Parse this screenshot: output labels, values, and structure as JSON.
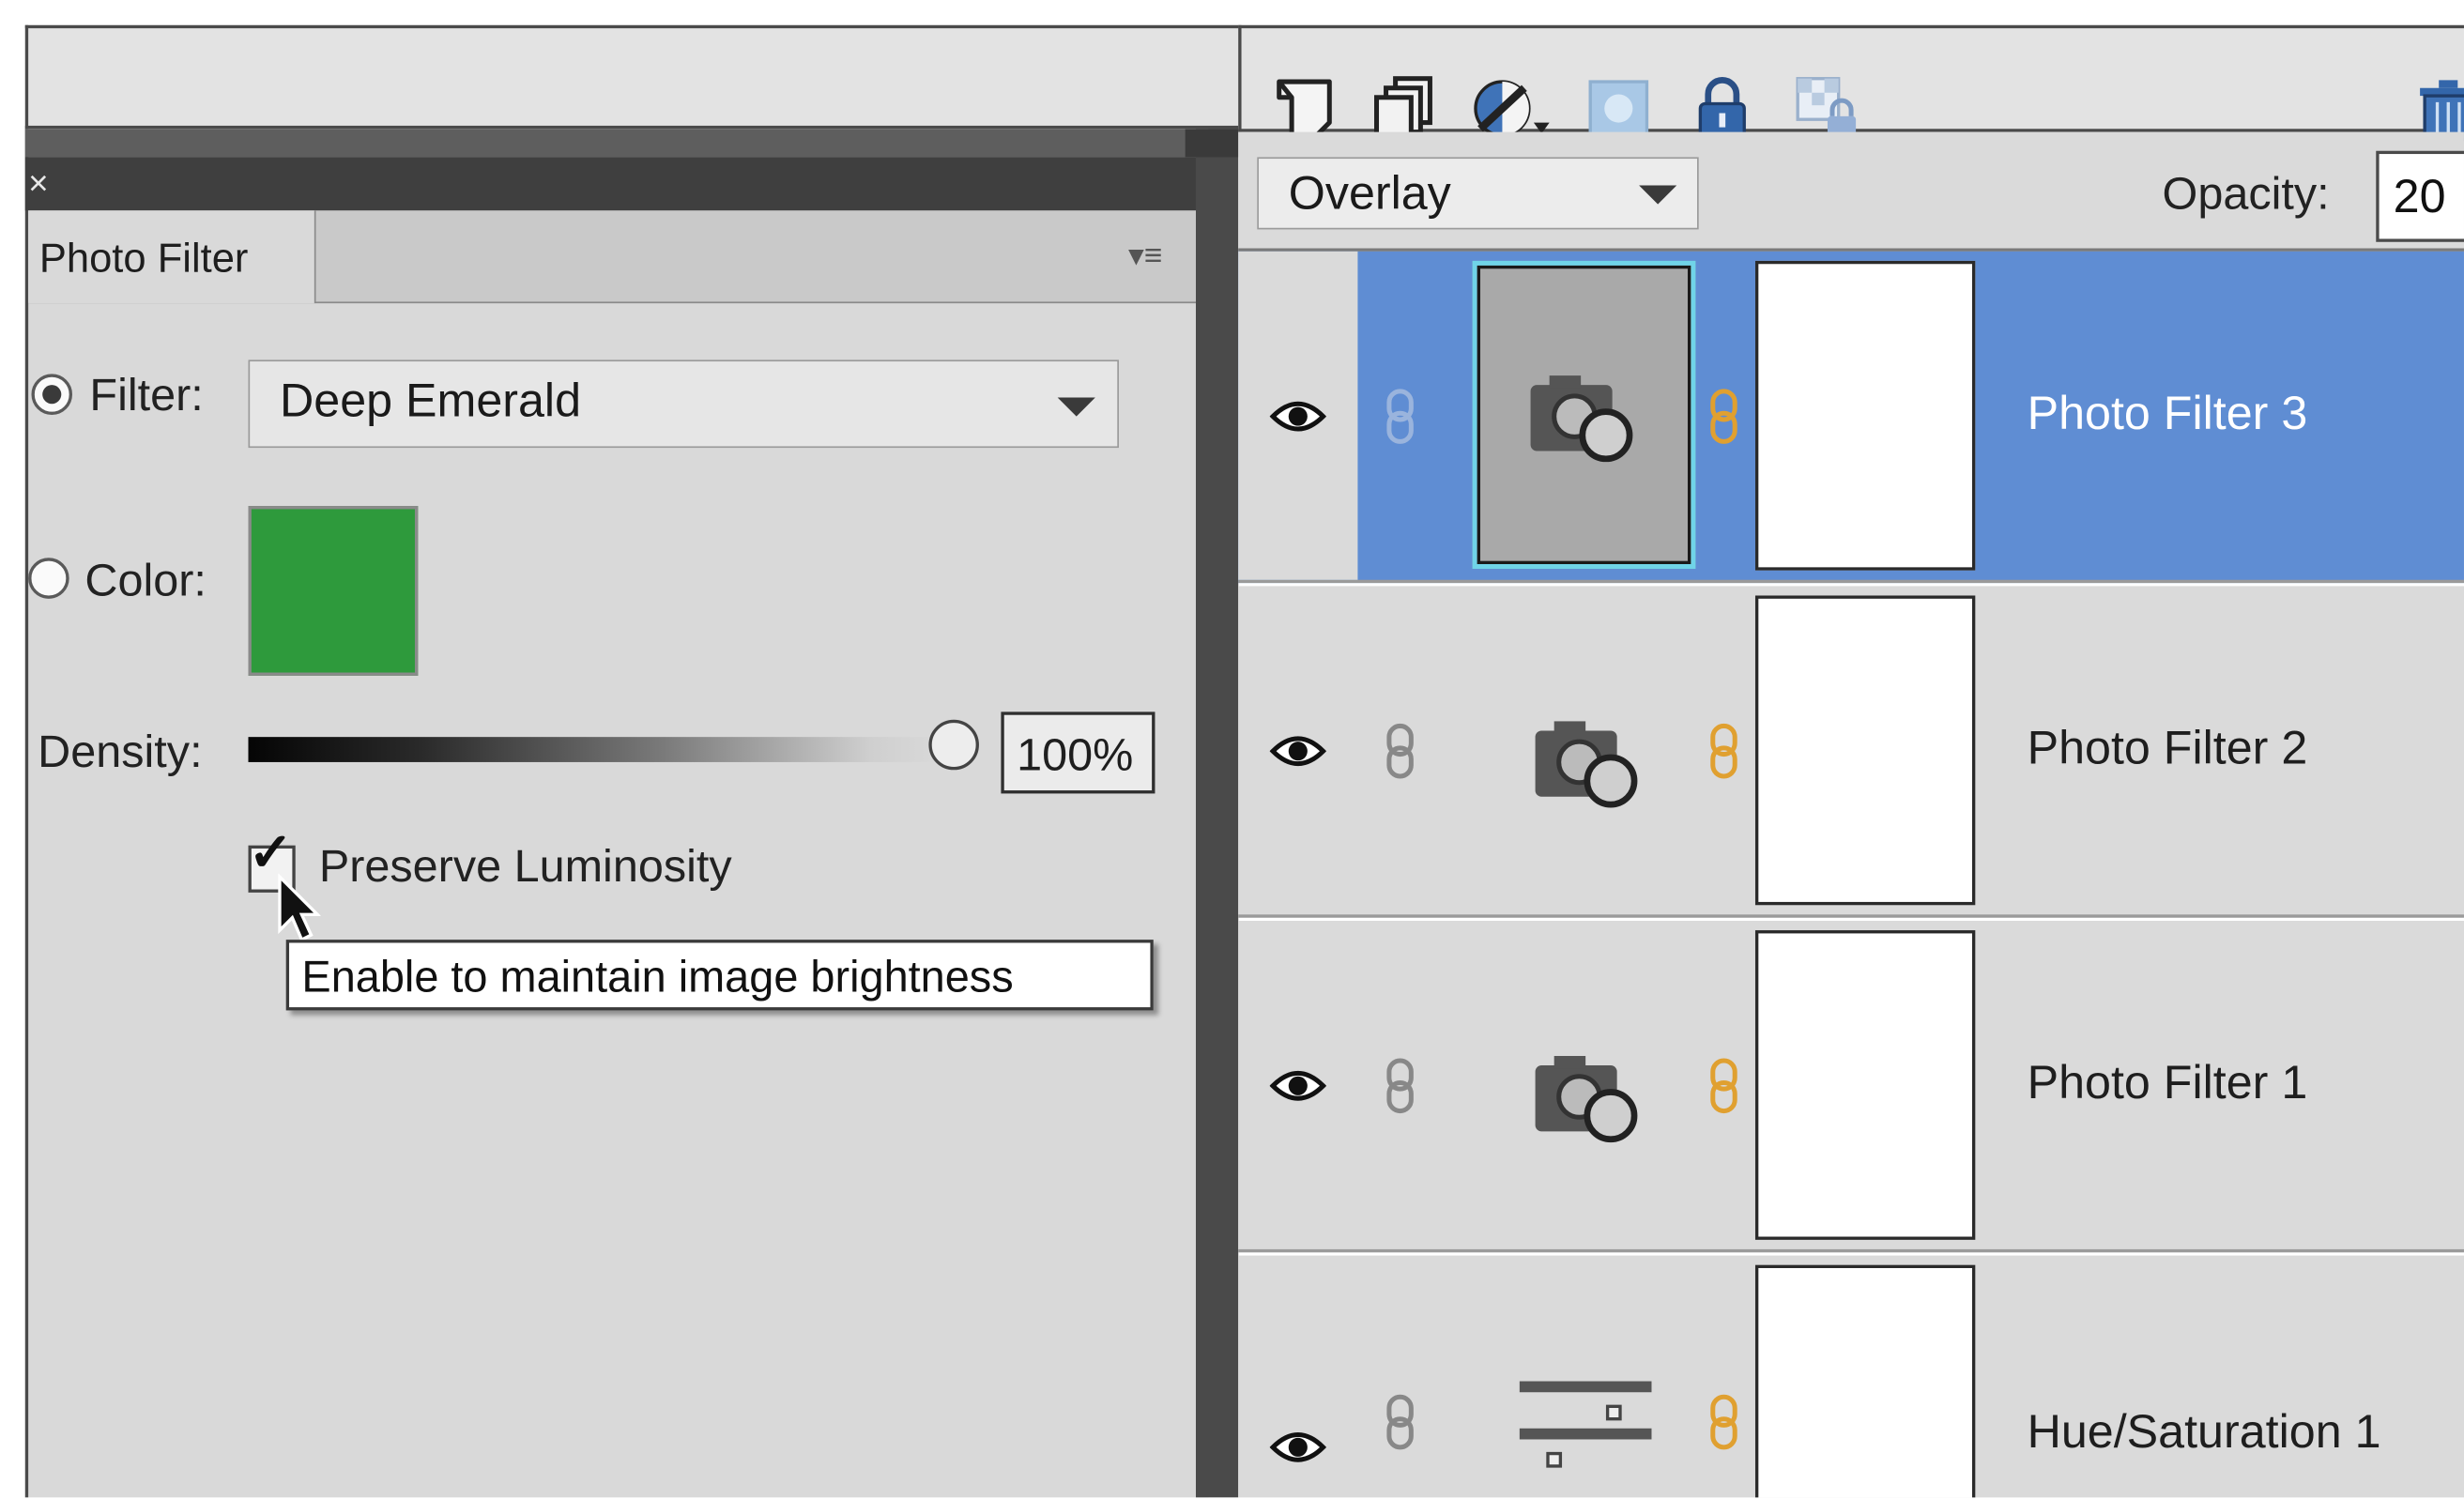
{
  "panel": {
    "close_glyph": "×",
    "tab_label": "Photo Filter",
    "filter_label": "Filter:",
    "filter_value": "Deep Emerald",
    "color_label": "Color:",
    "color_swatch": "#2e9a3c",
    "density_label": "Density:",
    "density_value": "100%",
    "density_level": 1.0,
    "preserve_label": "Preserve Luminosity",
    "preserve_checked": true,
    "tooltip": "Enable to maintain image brightness"
  },
  "layers_panel": {
    "toolbar_icons": [
      "new-layer-icon",
      "new-group-icon",
      "adjustment-layer-icon",
      "add-mask-icon",
      "lock-all-icon",
      "lock-transparency-icon",
      "trash-icon"
    ],
    "blend_mode": "Overlay",
    "opacity_label": "Opacity:",
    "opacity_value": "20",
    "layers": [
      {
        "name": "Photo Filter 3",
        "selected": true,
        "icon": "photo-filter-icon"
      },
      {
        "name": "Photo Filter 2",
        "selected": false,
        "icon": "photo-filter-icon"
      },
      {
        "name": "Photo Filter 1",
        "selected": false,
        "icon": "photo-filter-icon"
      },
      {
        "name": "Hue/Saturation 1",
        "selected": false,
        "icon": "hue-saturation-icon"
      }
    ]
  },
  "colors": {
    "selection_blue": "#5f8dd3",
    "thumb_highlight": "#70d4e8",
    "link_orange": "#e0a030"
  }
}
